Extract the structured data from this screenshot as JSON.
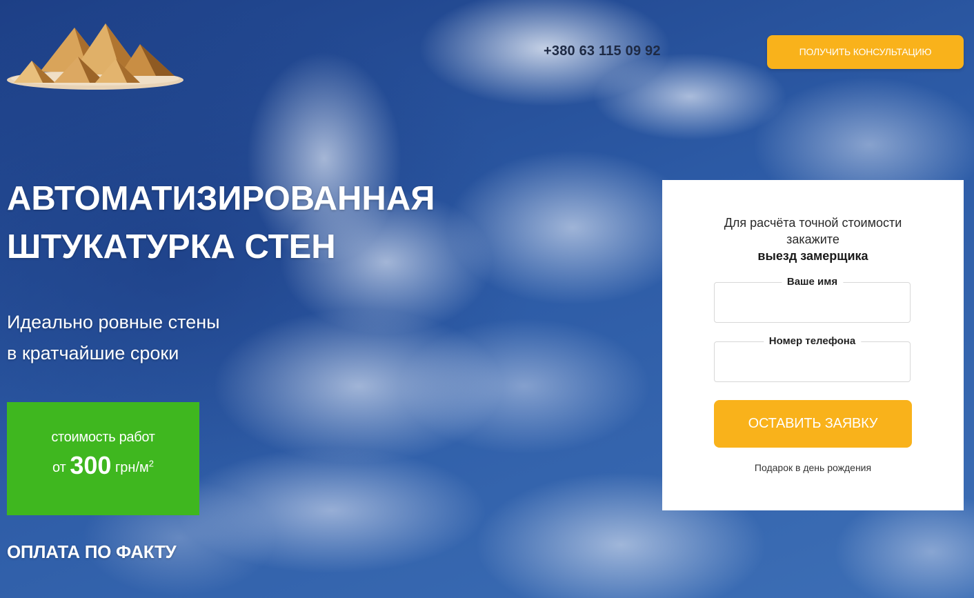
{
  "header": {
    "logo_icon": "pyramids-logo",
    "phone": "+380 63 115 09 92",
    "consult_button_label": "ПОЛУЧИТЬ КОНСУЛЬТАЦИЮ"
  },
  "hero": {
    "headline_line1": "АВТОМАТИЗИРОВАННАЯ",
    "headline_line2": "ШТУКАТУРКА СТЕН",
    "subtitle_line1": "Идеально ровные стены",
    "subtitle_line2": "в кратчайшие сроки"
  },
  "price": {
    "caption": "стоимость работ",
    "prefix": "от",
    "value": "300",
    "unit": "грн/м",
    "unit_exponent": "2",
    "background_color": "#3fb71f"
  },
  "payment_note": "ОПЛАТА ПО ФАКТУ",
  "form": {
    "intro_line1": "Для расчёта точной стоимости",
    "intro_line2_prefix": "закажите ",
    "intro_line2_bold": "выезд замерщика",
    "name_label": "Ваше имя",
    "name_value": "",
    "phone_label": "Номер телефона",
    "phone_value": "",
    "submit_label": "ОСТАВИТЬ ЗАЯВКУ",
    "gift_note": "Подарок в день рождения"
  },
  "colors": {
    "accent": "#f9b21b",
    "price_green": "#3fb71f",
    "sky_blue": "#2f5a9e"
  }
}
